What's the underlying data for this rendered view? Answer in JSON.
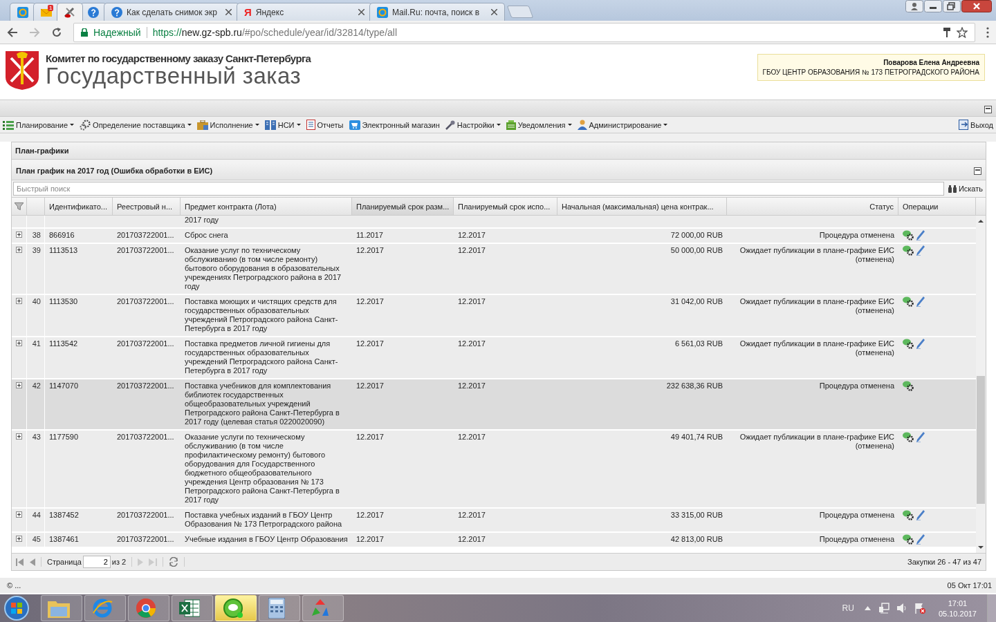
{
  "browser": {
    "tabs": [
      {
        "selected": false
      },
      {
        "selected": false,
        "badge": "1"
      },
      {
        "selected": true
      },
      {
        "selected": false
      },
      {
        "selected": false,
        "title": "Как сделать снимок экр"
      },
      {
        "selected": false,
        "title": "Яндекс",
        "glyph": "Я"
      },
      {
        "selected": false,
        "title": "Mail.Ru: почта, поиск в"
      }
    ],
    "secure_label": "Надежный",
    "url_scheme": "https://",
    "url_host": "new.gz-spb.ru",
    "url_path": "/#po/schedule/year/id/32814/type/all"
  },
  "header": {
    "subtitle": "Комитет по государственному заказу Санкт-Петербурга",
    "title": "Государственный заказ",
    "user_name": "Поварова Елена Андреевна",
    "user_org": "ГБОУ ЦЕНТР ОБРАЗОВАНИЯ № 173 ПЕТРОГРАДСКОГО РАЙОНА"
  },
  "menu": {
    "items": [
      {
        "label": "Планирование",
        "has_dropdown": true
      },
      {
        "label": "Определение поставщика",
        "has_dropdown": true
      },
      {
        "label": "Исполнение",
        "has_dropdown": true
      },
      {
        "label": "НСИ",
        "has_dropdown": true
      },
      {
        "label": "Отчеты",
        "has_dropdown": false
      },
      {
        "label": "Электронный магазин",
        "has_dropdown": false
      },
      {
        "label": "Настройки",
        "has_dropdown": true
      },
      {
        "label": "Уведомления",
        "has_dropdown": true
      },
      {
        "label": "Администрирование",
        "has_dropdown": true
      }
    ],
    "logout": "Выход"
  },
  "panel": {
    "title": "План-графики",
    "subtitle": "План график на 2017 год (Ошибка обработки в ЕИС)",
    "search": {
      "placeholder": "Быстрый поиск",
      "button": "Искать"
    }
  },
  "table": {
    "columns": [
      {
        "label": "Идентификато...",
        "sorted": false
      },
      {
        "label": "Реестровый н...",
        "sorted": false
      },
      {
        "label": "Предмет контракта (Лота)",
        "sorted": false
      },
      {
        "label": "Планируемый срок разм...",
        "sorted": true
      },
      {
        "label": "Планируемый срок испо...",
        "sorted": false
      },
      {
        "label": "Начальная (максимальная) цена контрак...",
        "sorted": false
      },
      {
        "label": "Статус",
        "sorted": false
      },
      {
        "label": "Операции",
        "sorted": false
      }
    ],
    "top_fragment": "2017 году",
    "rows": [
      {
        "num": "38",
        "id": "866916",
        "reg": "201703722001...",
        "subject": "Сброс снега",
        "date1": "11.2017",
        "date2": "12.2017",
        "price": "72 000,00 RUB",
        "status": "Процедура отменена",
        "editable": true,
        "selected": false
      },
      {
        "num": "39",
        "id": "1113513",
        "reg": "201703722001...",
        "subject": "Оказание услуг по техническому обслуживанию (в том числе ремонту) бытового оборудования в образовательных учреждениях Петроградского района в 2017 году",
        "date1": "12.2017",
        "date2": "12.2017",
        "price": "50 000,00 RUB",
        "status": "Ожидает публикации в плане-графике ЕИС (отменена)",
        "editable": true,
        "selected": false
      },
      {
        "num": "40",
        "id": "1113530",
        "reg": "201703722001...",
        "subject": "Поставка моющих и чистящих средств для государственных образовательных учреждений Петроградского района Санкт-Петербурга в 2017 году",
        "date1": "12.2017",
        "date2": "12.2017",
        "price": "31 042,00 RUB",
        "status": "Ожидает публикации в плане-графике ЕИС (отменена)",
        "editable": true,
        "selected": false
      },
      {
        "num": "41",
        "id": "1113542",
        "reg": "201703722001...",
        "subject": "Поставка предметов личной гигиены для государственных образовательных учреждений Петроградского района Санкт-Петербурга в 2017 году",
        "date1": "12.2017",
        "date2": "12.2017",
        "price": "6 561,03 RUB",
        "status": "Ожидает публикации в плане-графике ЕИС (отменена)",
        "editable": true,
        "selected": false
      },
      {
        "num": "42",
        "id": "1147070",
        "reg": "201703722001...",
        "subject": "Поставка учебников для комплектования библиотек государственных общеобразовательных учреждений Петроградского района Санкт-Петербурга в 2017 году (целевая статья 0220020090)",
        "date1": "12.2017",
        "date2": "12.2017",
        "price": "232 638,36 RUB",
        "status": "Процедура отменена",
        "editable": false,
        "selected": true
      },
      {
        "num": "43",
        "id": "1177590",
        "reg": "201703722001...",
        "subject": "Оказание услуги по техническому обслуживанию (в том числе профилактическому ремонту) бытового оборудования для Государственного бюджетного общеобразовательного учреждения Центр образования № 173 Петроградского района Санкт-Петербурга в 2017 году",
        "date1": "12.2017",
        "date2": "12.2017",
        "price": "49 401,74 RUB",
        "status": "Ожидает публикации в плане-графике ЕИС (отменена)",
        "editable": true,
        "selected": false
      },
      {
        "num": "44",
        "id": "1387452",
        "reg": "201703722001...",
        "subject": "Поставка учебных изданий в ГБОУ Центр Образования № 173 Петроградского района",
        "date1": "12.2017",
        "date2": "12.2017",
        "price": "33 315,00 RUB",
        "status": "Процедура отменена",
        "editable": true,
        "selected": false
      },
      {
        "num": "45",
        "id": "1387461",
        "reg": "201703722001...",
        "subject": "Учебные издания в ГБОУ Центр Образования",
        "date1": "12.2017",
        "date2": "12.2017",
        "price": "42 813,00 RUB",
        "status": "Процедура отменена",
        "editable": true,
        "selected": false
      }
    ]
  },
  "pager": {
    "page_label": "Страница",
    "page": "2",
    "of": "из 2",
    "summary": "Закупки 26 - 47 из 47"
  },
  "footer": {
    "copyright": "© ...",
    "datetime": "05 Окт 17:01"
  },
  "taskbar": {
    "apps": [
      {
        "selected": false
      },
      {
        "selected": false
      },
      {
        "selected": false
      },
      {
        "selected": false
      },
      {
        "selected": true
      },
      {
        "selected": false
      },
      {
        "selected": false
      }
    ],
    "lang": "RU",
    "time": "17:01",
    "date": "05.10.2017"
  }
}
